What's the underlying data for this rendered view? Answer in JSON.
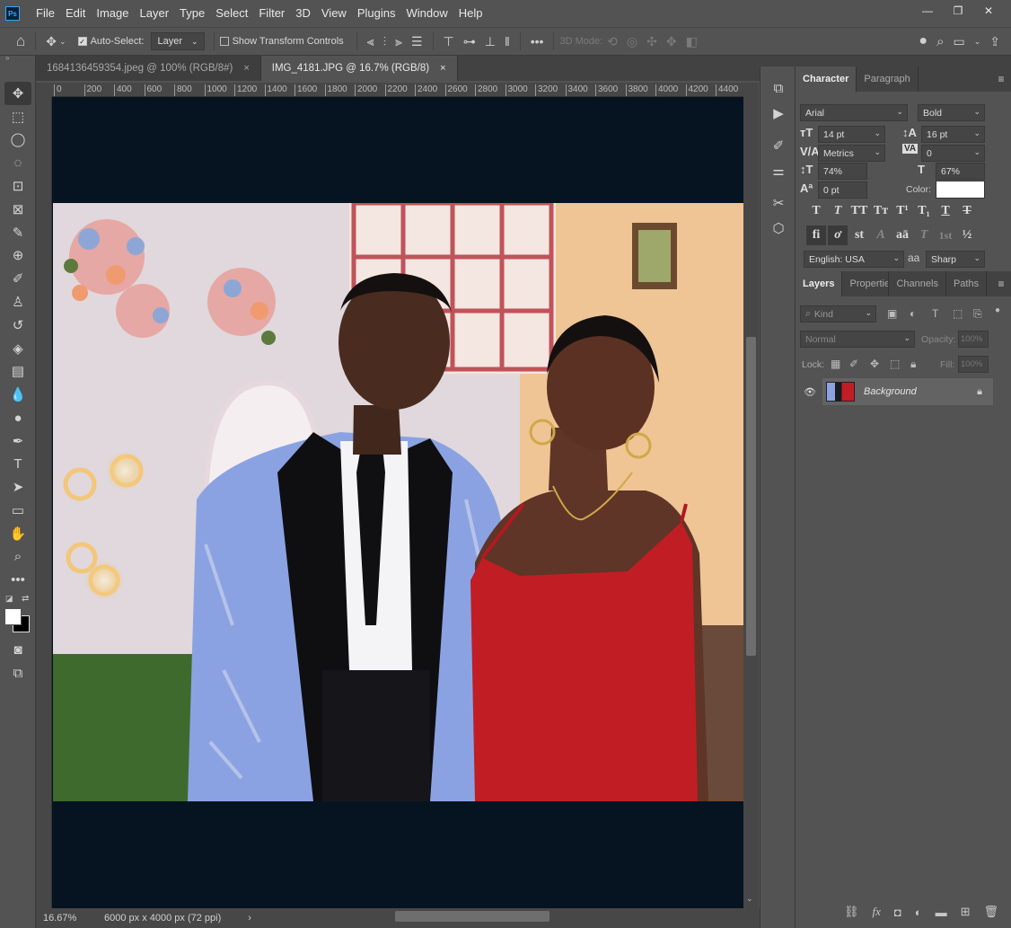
{
  "menu": [
    "File",
    "Edit",
    "Image",
    "Layer",
    "Type",
    "Select",
    "Filter",
    "3D",
    "View",
    "Plugins",
    "Window",
    "Help"
  ],
  "app_logo": "Ps",
  "window_controls": {
    "minimize": "—",
    "restore": "❐",
    "close": "✕"
  },
  "options": {
    "auto_select_label": "Auto-Select:",
    "auto_select_value": "Layer",
    "show_transform_label": "Show Transform Controls",
    "mode_3d_label": "3D Mode:"
  },
  "tabs": [
    {
      "label": "1684136459354.jpeg @ 100% (RGB/8#)",
      "close": "×"
    },
    {
      "label": "IMG_4181.JPG @ 16.7% (RGB/8)",
      "close": "×"
    }
  ],
  "ruler_h": [
    "0",
    "200",
    "400",
    "600",
    "800",
    "1000",
    "1200",
    "1400",
    "1600",
    "1800",
    "2000",
    "2200",
    "2400",
    "2600",
    "2800",
    "3000",
    "3200",
    "3400",
    "3600",
    "3800",
    "4000",
    "4200",
    "4400"
  ],
  "status": {
    "zoom": "16.67%",
    "doc_size": "6000 px x 4000 px (72 ppi)",
    "arrow": "›"
  },
  "character": {
    "tab_character": "Character",
    "tab_paragraph": "Paragraph",
    "font_family": "Arial",
    "font_style": "Bold",
    "size": "14 pt",
    "leading": "16 pt",
    "kerning": "Metrics",
    "tracking": "0",
    "vscale": "74%",
    "hscale": "67%",
    "baseline": "0 pt",
    "color_label": "Color:",
    "color_value": "#ffffff",
    "language": "English: USA",
    "aa_label": "aa",
    "antialias": "Sharp"
  },
  "type_buttons": [
    "T",
    "T",
    "TT",
    "Tт",
    "T¹",
    "T₁",
    "T",
    "T"
  ],
  "type_buttons2": [
    "fi",
    "ơ",
    "st",
    "A",
    "aā",
    "T",
    "1st",
    "½"
  ],
  "layers": {
    "tabs": [
      "Layers",
      "Properties",
      "Channels",
      "Paths"
    ],
    "kind": "Kind",
    "blend": "Normal",
    "opacity_label": "Opacity:",
    "opacity": "100%",
    "lock_label": "Lock:",
    "fill_label": "Fill:",
    "fill": "100%",
    "items": [
      {
        "name": "Background",
        "locked": true
      }
    ]
  },
  "footer_icons": [
    "link-icon",
    "fx-icon",
    "mask-icon",
    "adjustment-icon",
    "folder-icon",
    "new-layer-icon",
    "trash-icon"
  ]
}
